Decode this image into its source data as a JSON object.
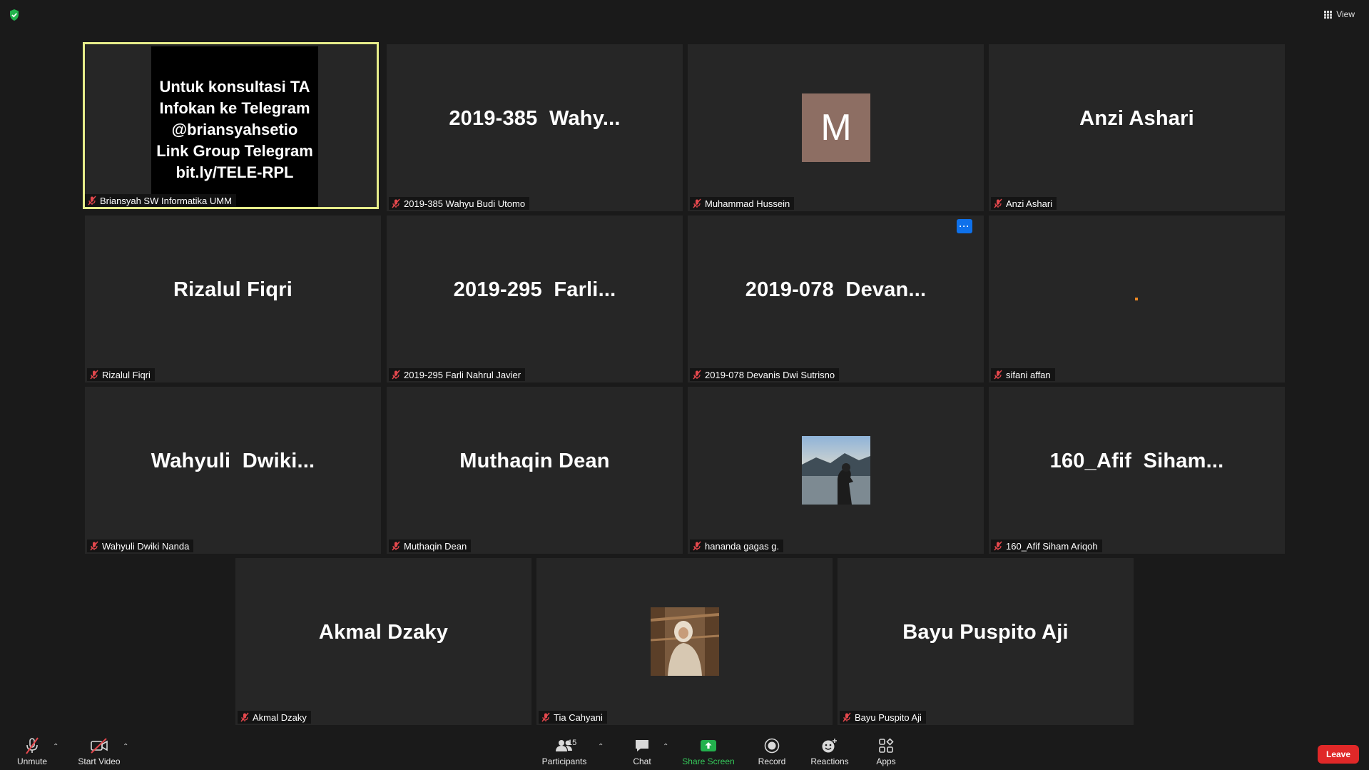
{
  "top": {
    "view_label": "View"
  },
  "tiles": [
    {
      "display_name": "",
      "name": "Briansyah SW Informatika UMM",
      "share_lines": [
        "Untuk konsultasi TA",
        "Infokan ke Telegram",
        "@briansyahsetio",
        "Link Group Telegram",
        "bit.ly/TELE-RPL"
      ]
    },
    {
      "display_name": "2019-385  Wahy...",
      "name": "2019-385 Wahyu Budi Utomo"
    },
    {
      "display_name": "",
      "avatar_letter": "M",
      "name": "Muhammad Hussein"
    },
    {
      "display_name": "Anzi Ashari",
      "name": "Anzi Ashari"
    },
    {
      "display_name": "Rizalul Fiqri",
      "name": "Rizalul Fiqri"
    },
    {
      "display_name": "2019-295  Farli...",
      "name": "2019-295 Farli Nahrul Javier"
    },
    {
      "display_name": "2019-078  Devan...",
      "name": "2019-078 Devanis Dwi Sutrisno",
      "more_label": "···"
    },
    {
      "display_name": "",
      "name": "sifani affan"
    },
    {
      "display_name": "Wahyuli  Dwiki...",
      "name": "Wahyuli Dwiki Nanda"
    },
    {
      "display_name": "Muthaqin Dean",
      "name": "Muthaqin Dean"
    },
    {
      "display_name": "",
      "name": "hananda gagas g."
    },
    {
      "display_name": "160_Afif  Siham...",
      "name": "160_Afif Siham Ariqoh"
    },
    {
      "display_name": "Akmal Dzaky",
      "name": "Akmal Dzaky"
    },
    {
      "display_name": "",
      "name": "Tia Cahyani"
    },
    {
      "display_name": "Bayu Puspito Aji",
      "name": "Bayu Puspito Aji"
    }
  ],
  "toolbar": {
    "unmute": "Unmute",
    "start_video": "Start Video",
    "participants": "Participants",
    "participants_count": "15",
    "chat": "Chat",
    "share_screen": "Share Screen",
    "record": "Record",
    "reactions": "Reactions",
    "apps": "Apps",
    "leave": "Leave"
  },
  "colors": {
    "active_speaker_border": "#e6ec8a",
    "share_green": "#35c759",
    "leave_red": "#e02828",
    "more_blue": "#0e71eb",
    "mute_red": "#e5484d"
  }
}
